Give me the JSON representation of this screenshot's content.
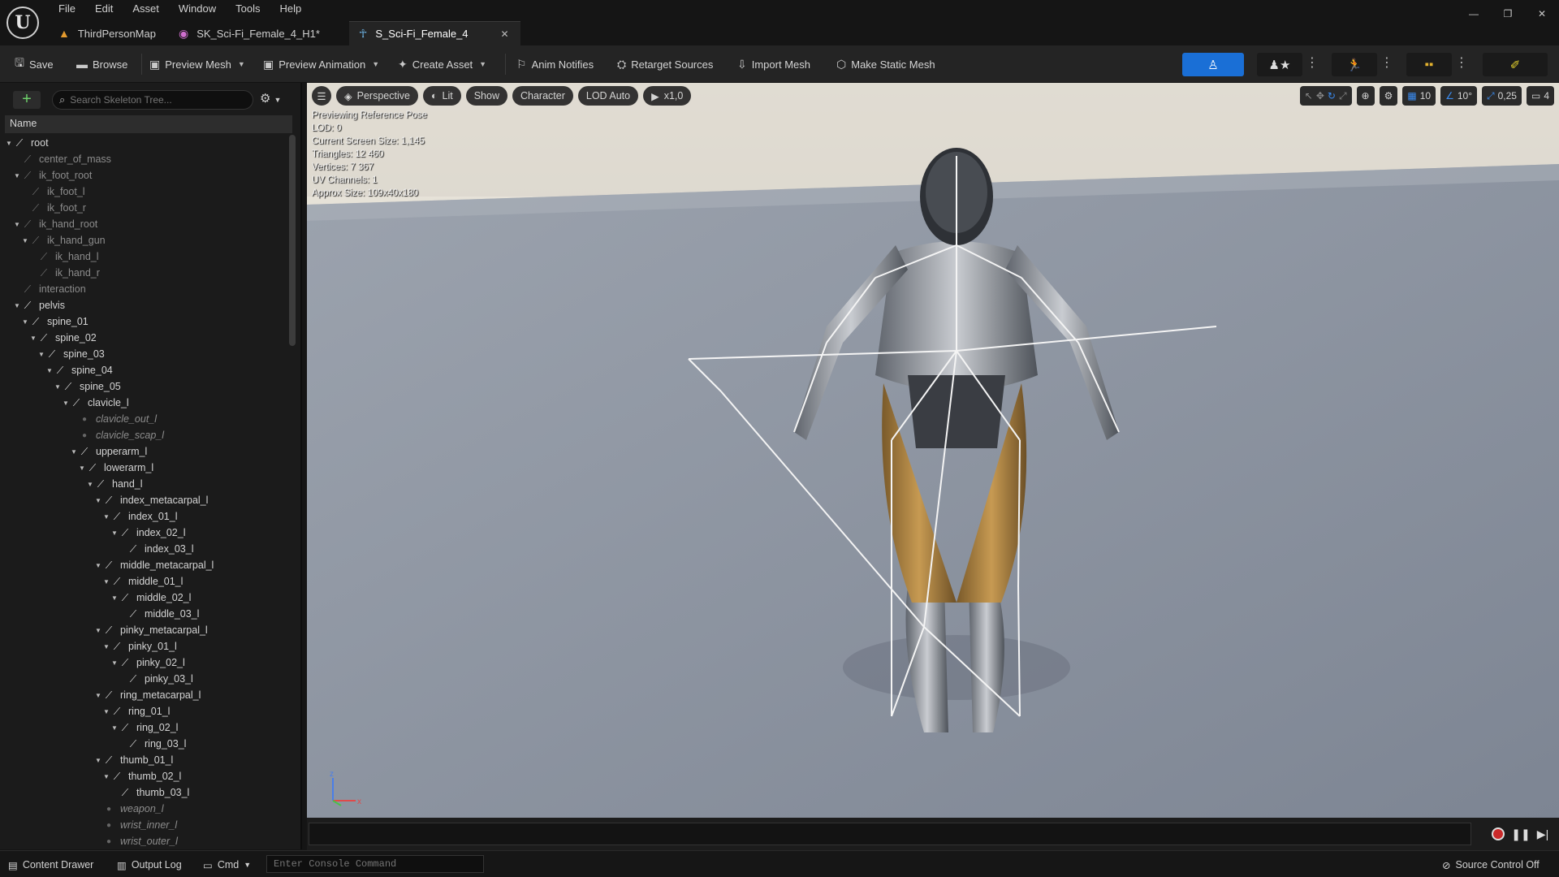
{
  "menu": [
    "File",
    "Edit",
    "Asset",
    "Window",
    "Tools",
    "Help"
  ],
  "tabs": [
    {
      "label": "ThirdPersonMap",
      "icon": "level-icon"
    },
    {
      "label": "SK_Sci-Fi_Female_4_H1*",
      "icon": "mesh-icon"
    },
    {
      "label": "S_Sci-Fi_Female_4",
      "icon": "skeleton-icon"
    }
  ],
  "toolbar": {
    "save": "Save",
    "browse": "Browse",
    "preview_mesh": "Preview Mesh",
    "preview_animation": "Preview Animation",
    "create_asset": "Create Asset",
    "anim_notifies": "Anim Notifies",
    "retarget_sources": "Retarget Sources",
    "import_mesh": "Import Mesh",
    "make_static_mesh": "Make Static Mesh"
  },
  "skeleton_tree": {
    "search_placeholder": "Search Skeleton Tree...",
    "column": "Name",
    "rows": [
      {
        "label": "root",
        "depth": 0,
        "kind": "bone",
        "exp": true
      },
      {
        "label": "center_of_mass",
        "depth": 1,
        "kind": "dim"
      },
      {
        "label": "ik_foot_root",
        "depth": 1,
        "kind": "dim",
        "exp": true
      },
      {
        "label": "ik_foot_l",
        "depth": 2,
        "kind": "dim"
      },
      {
        "label": "ik_foot_r",
        "depth": 2,
        "kind": "dim"
      },
      {
        "label": "ik_hand_root",
        "depth": 1,
        "kind": "dim",
        "exp": true
      },
      {
        "label": "ik_hand_gun",
        "depth": 2,
        "kind": "dim",
        "exp": true
      },
      {
        "label": "ik_hand_l",
        "depth": 3,
        "kind": "dim"
      },
      {
        "label": "ik_hand_r",
        "depth": 3,
        "kind": "dim"
      },
      {
        "label": "interaction",
        "depth": 1,
        "kind": "dim"
      },
      {
        "label": "pelvis",
        "depth": 1,
        "kind": "bone",
        "exp": true
      },
      {
        "label": "spine_01",
        "depth": 2,
        "kind": "bone",
        "exp": true
      },
      {
        "label": "spine_02",
        "depth": 3,
        "kind": "bone",
        "exp": true
      },
      {
        "label": "spine_03",
        "depth": 4,
        "kind": "bone",
        "exp": true
      },
      {
        "label": "spine_04",
        "depth": 5,
        "kind": "bone",
        "exp": true
      },
      {
        "label": "spine_05",
        "depth": 6,
        "kind": "bone",
        "exp": true
      },
      {
        "label": "clavicle_l",
        "depth": 7,
        "kind": "bone",
        "exp": true
      },
      {
        "label": "clavicle_out_l",
        "depth": 8,
        "kind": "virtual"
      },
      {
        "label": "clavicle_scap_l",
        "depth": 8,
        "kind": "virtual"
      },
      {
        "label": "upperarm_l",
        "depth": 8,
        "kind": "bone",
        "exp": true
      },
      {
        "label": "lowerarm_l",
        "depth": 9,
        "kind": "bone",
        "exp": true
      },
      {
        "label": "hand_l",
        "depth": 10,
        "kind": "bone",
        "exp": true
      },
      {
        "label": "index_metacarpal_l",
        "depth": 11,
        "kind": "bone",
        "exp": true
      },
      {
        "label": "index_01_l",
        "depth": 12,
        "kind": "bone",
        "exp": true
      },
      {
        "label": "index_02_l",
        "depth": 13,
        "kind": "bone",
        "exp": true
      },
      {
        "label": "index_03_l",
        "depth": 14,
        "kind": "bone"
      },
      {
        "label": "middle_metacarpal_l",
        "depth": 11,
        "kind": "bone",
        "exp": true
      },
      {
        "label": "middle_01_l",
        "depth": 12,
        "kind": "bone",
        "exp": true
      },
      {
        "label": "middle_02_l",
        "depth": 13,
        "kind": "bone",
        "exp": true
      },
      {
        "label": "middle_03_l",
        "depth": 14,
        "kind": "bone"
      },
      {
        "label": "pinky_metacarpal_l",
        "depth": 11,
        "kind": "bone",
        "exp": true
      },
      {
        "label": "pinky_01_l",
        "depth": 12,
        "kind": "bone",
        "exp": true
      },
      {
        "label": "pinky_02_l",
        "depth": 13,
        "kind": "bone",
        "exp": true
      },
      {
        "label": "pinky_03_l",
        "depth": 14,
        "kind": "bone"
      },
      {
        "label": "ring_metacarpal_l",
        "depth": 11,
        "kind": "bone",
        "exp": true
      },
      {
        "label": "ring_01_l",
        "depth": 12,
        "kind": "bone",
        "exp": true
      },
      {
        "label": "ring_02_l",
        "depth": 13,
        "kind": "bone",
        "exp": true
      },
      {
        "label": "ring_03_l",
        "depth": 14,
        "kind": "bone"
      },
      {
        "label": "thumb_01_l",
        "depth": 11,
        "kind": "bone",
        "exp": true
      },
      {
        "label": "thumb_02_l",
        "depth": 12,
        "kind": "bone",
        "exp": true
      },
      {
        "label": "thumb_03_l",
        "depth": 13,
        "kind": "bone"
      },
      {
        "label": "weapon_l",
        "depth": 11,
        "kind": "virtual"
      },
      {
        "label": "wrist_inner_l",
        "depth": 11,
        "kind": "virtual"
      },
      {
        "label": "wrist_outer_l",
        "depth": 11,
        "kind": "virtual"
      }
    ]
  },
  "viewport": {
    "perspective": "Perspective",
    "lit": "Lit",
    "show": "Show",
    "character": "Character",
    "lod": "LOD Auto",
    "speed": "x1,0",
    "grid": "10",
    "angle": "10°",
    "scale": "0,25",
    "camera": "4",
    "stats": [
      "Previewing Reference Pose",
      "LOD: 0",
      "Current Screen Size: 1,145",
      "Triangles: 12 460",
      "Vertices: 7 367",
      "UV Channels: 1",
      "Approx Size: 109x40x180"
    ]
  },
  "status": {
    "content_drawer": "Content Drawer",
    "output_log": "Output Log",
    "cmd": "Cmd",
    "console_placeholder": "Enter Console Command",
    "source_control": "Source Control Off"
  },
  "colors": {
    "accent": "#1a6fd6",
    "panel": "#1b1b1b",
    "viewport": "#8d95a1"
  }
}
